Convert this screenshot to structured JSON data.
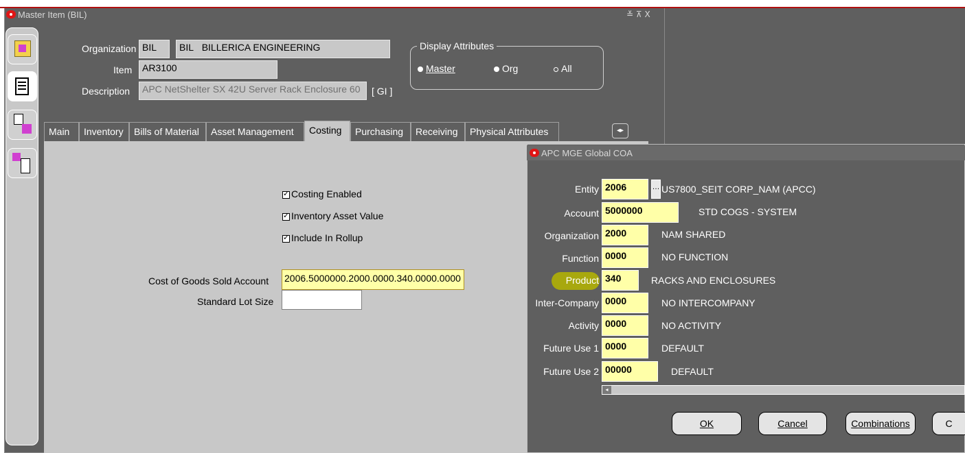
{
  "window": {
    "title": "Master Item (BIL)",
    "controls": "≚ ⊼ X"
  },
  "header": {
    "organization_label": "Organization",
    "organization_code": "BIL",
    "organization_code2": "BIL",
    "organization_name": "BILLERICA ENGINEERING",
    "item_label": "Item",
    "item_value": "AR3100",
    "description_label": "Description",
    "description_value": "APC NetShelter SX 42U Server Rack Enclosure 60",
    "gl_button": "[ GI ]"
  },
  "display_attributes": {
    "title": "Display Attributes",
    "options": [
      "Master",
      "Org",
      "All"
    ],
    "selected": "Master"
  },
  "tabs": [
    {
      "label": "Main"
    },
    {
      "label": "Inventory"
    },
    {
      "label": "Bills of Material"
    },
    {
      "label": "Asset Management"
    },
    {
      "label": "Costing",
      "active": true
    },
    {
      "label": "Purchasing"
    },
    {
      "label": "Receiving"
    },
    {
      "label": "Physical Attributes"
    }
  ],
  "tab_scroll": "◂▸",
  "costing": {
    "costing_enabled": "Costing Enabled",
    "inventory_asset_value": "Inventory Asset Value",
    "include_in_rollup": "Include In Rollup",
    "cogs_label": "Cost of Goods Sold Account",
    "cogs_value": "2006.5000000.2000.0000.340.0000.0000",
    "lot_size_label": "Standard Lot Size",
    "lot_size_value": ""
  },
  "dialog": {
    "title": "APC MGE Global COA",
    "segments": [
      {
        "label": "Entity",
        "value": "2006",
        "desc": "US7800_SEIT CORP_NAM (APCC)"
      },
      {
        "label": "Account",
        "value": "5000000",
        "desc": "STD COGS - SYSTEM"
      },
      {
        "label": "Organization",
        "value": "2000",
        "desc": "NAM SHARED"
      },
      {
        "label": "Function",
        "value": "0000",
        "desc": "NO FUNCTION"
      },
      {
        "label": "Product",
        "value": "340",
        "desc": "RACKS AND ENCLOSURES"
      },
      {
        "label": "Inter-Company",
        "value": "0000",
        "desc": "NO INTERCOMPANY"
      },
      {
        "label": "Activity",
        "value": "0000",
        "desc": "NO ACTIVITY"
      },
      {
        "label": "Future Use 1",
        "value": "0000",
        "desc": "DEFAULT"
      },
      {
        "label": "Future Use 2",
        "value": "00000",
        "desc": "DEFAULT"
      }
    ],
    "buttons": {
      "ok": "OK",
      "cancel": "Cancel",
      "combinations": "Combinations",
      "clear": "C"
    }
  },
  "colors": {
    "highlight": "#b5b500",
    "field_yellow": "#ffffa8",
    "title_red": "#e01515"
  }
}
